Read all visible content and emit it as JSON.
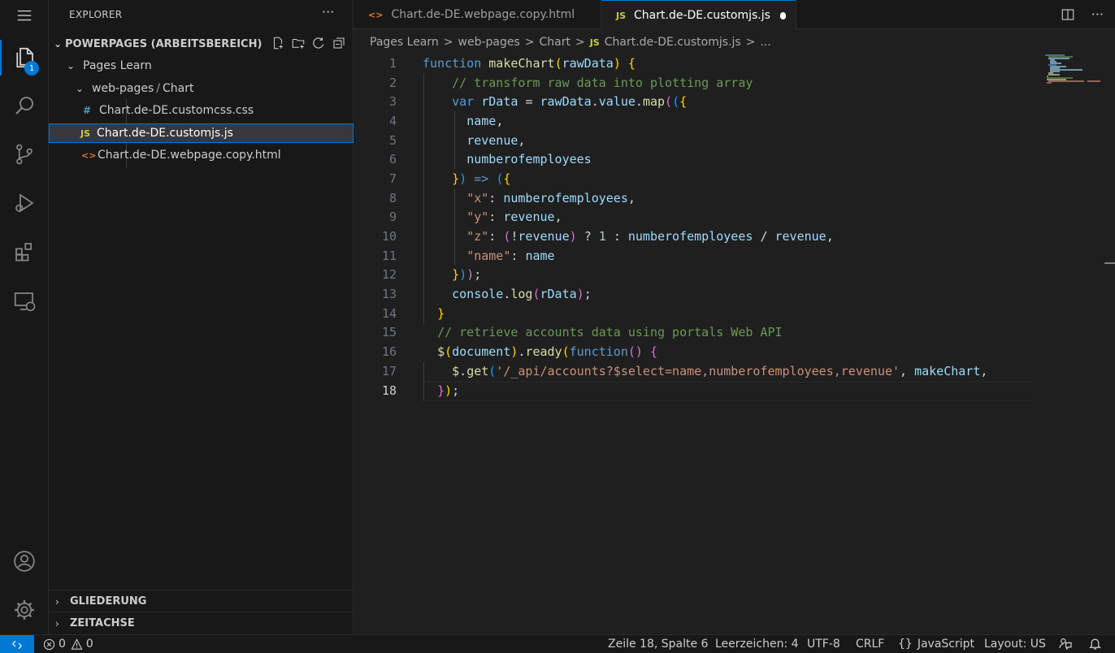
{
  "sidebar": {
    "title": "EXPLORER",
    "more": "···",
    "workspace": "POWERPAGES (ARBEITSBEREICH)",
    "tree": {
      "folder1": "Pages Learn",
      "folder2a": "web-pages",
      "folder2sep": "/",
      "folder2b": "Chart",
      "file_css_icon": "#",
      "file_css": "Chart.de-DE.customcss.css",
      "file_js_icon": "JS",
      "file_js": "Chart.de-DE.customjs.js",
      "file_html_icon": "<>",
      "file_html": "Chart.de-DE.webpage.copy.html"
    },
    "outline": "GLIEDERUNG",
    "timeline": "ZEITACHSE"
  },
  "activity": {
    "explorer_badge": "1"
  },
  "tabs": {
    "tab1": "Chart.de-DE.webpage.copy.html",
    "tab2_icon": "JS",
    "tab2": "Chart.de-DE.customjs.js",
    "more": "···"
  },
  "breadcrumb": {
    "p1": "Pages Learn",
    "p2": "web-pages",
    "p3": "Chart",
    "p4_icon": "JS",
    "p4": "Chart.de-DE.customjs.js",
    "p5": "...",
    "sep": ">"
  },
  "editor": {
    "current_line": 18,
    "line_numbers": [
      "1",
      "2",
      "3",
      "4",
      "5",
      "6",
      "7",
      "8",
      "9",
      "10",
      "11",
      "12",
      "13",
      "14",
      "15",
      "16",
      "17",
      "18"
    ]
  },
  "status": {
    "errors": "0",
    "warnings": "0",
    "position": "Zeile 18, Spalte 6",
    "indent": "Leerzeichen: 4",
    "encoding": "UTF-8",
    "eol": "CRLF",
    "language_icon": "{}",
    "language": "JavaScript",
    "layout": "Layout: US"
  },
  "colors": {
    "accent": "#0078d4",
    "keyword": "#569cd6",
    "function": "#dcdcaa",
    "variable": "#9cdcfe",
    "comment": "#6a9955",
    "string": "#ce9178"
  }
}
